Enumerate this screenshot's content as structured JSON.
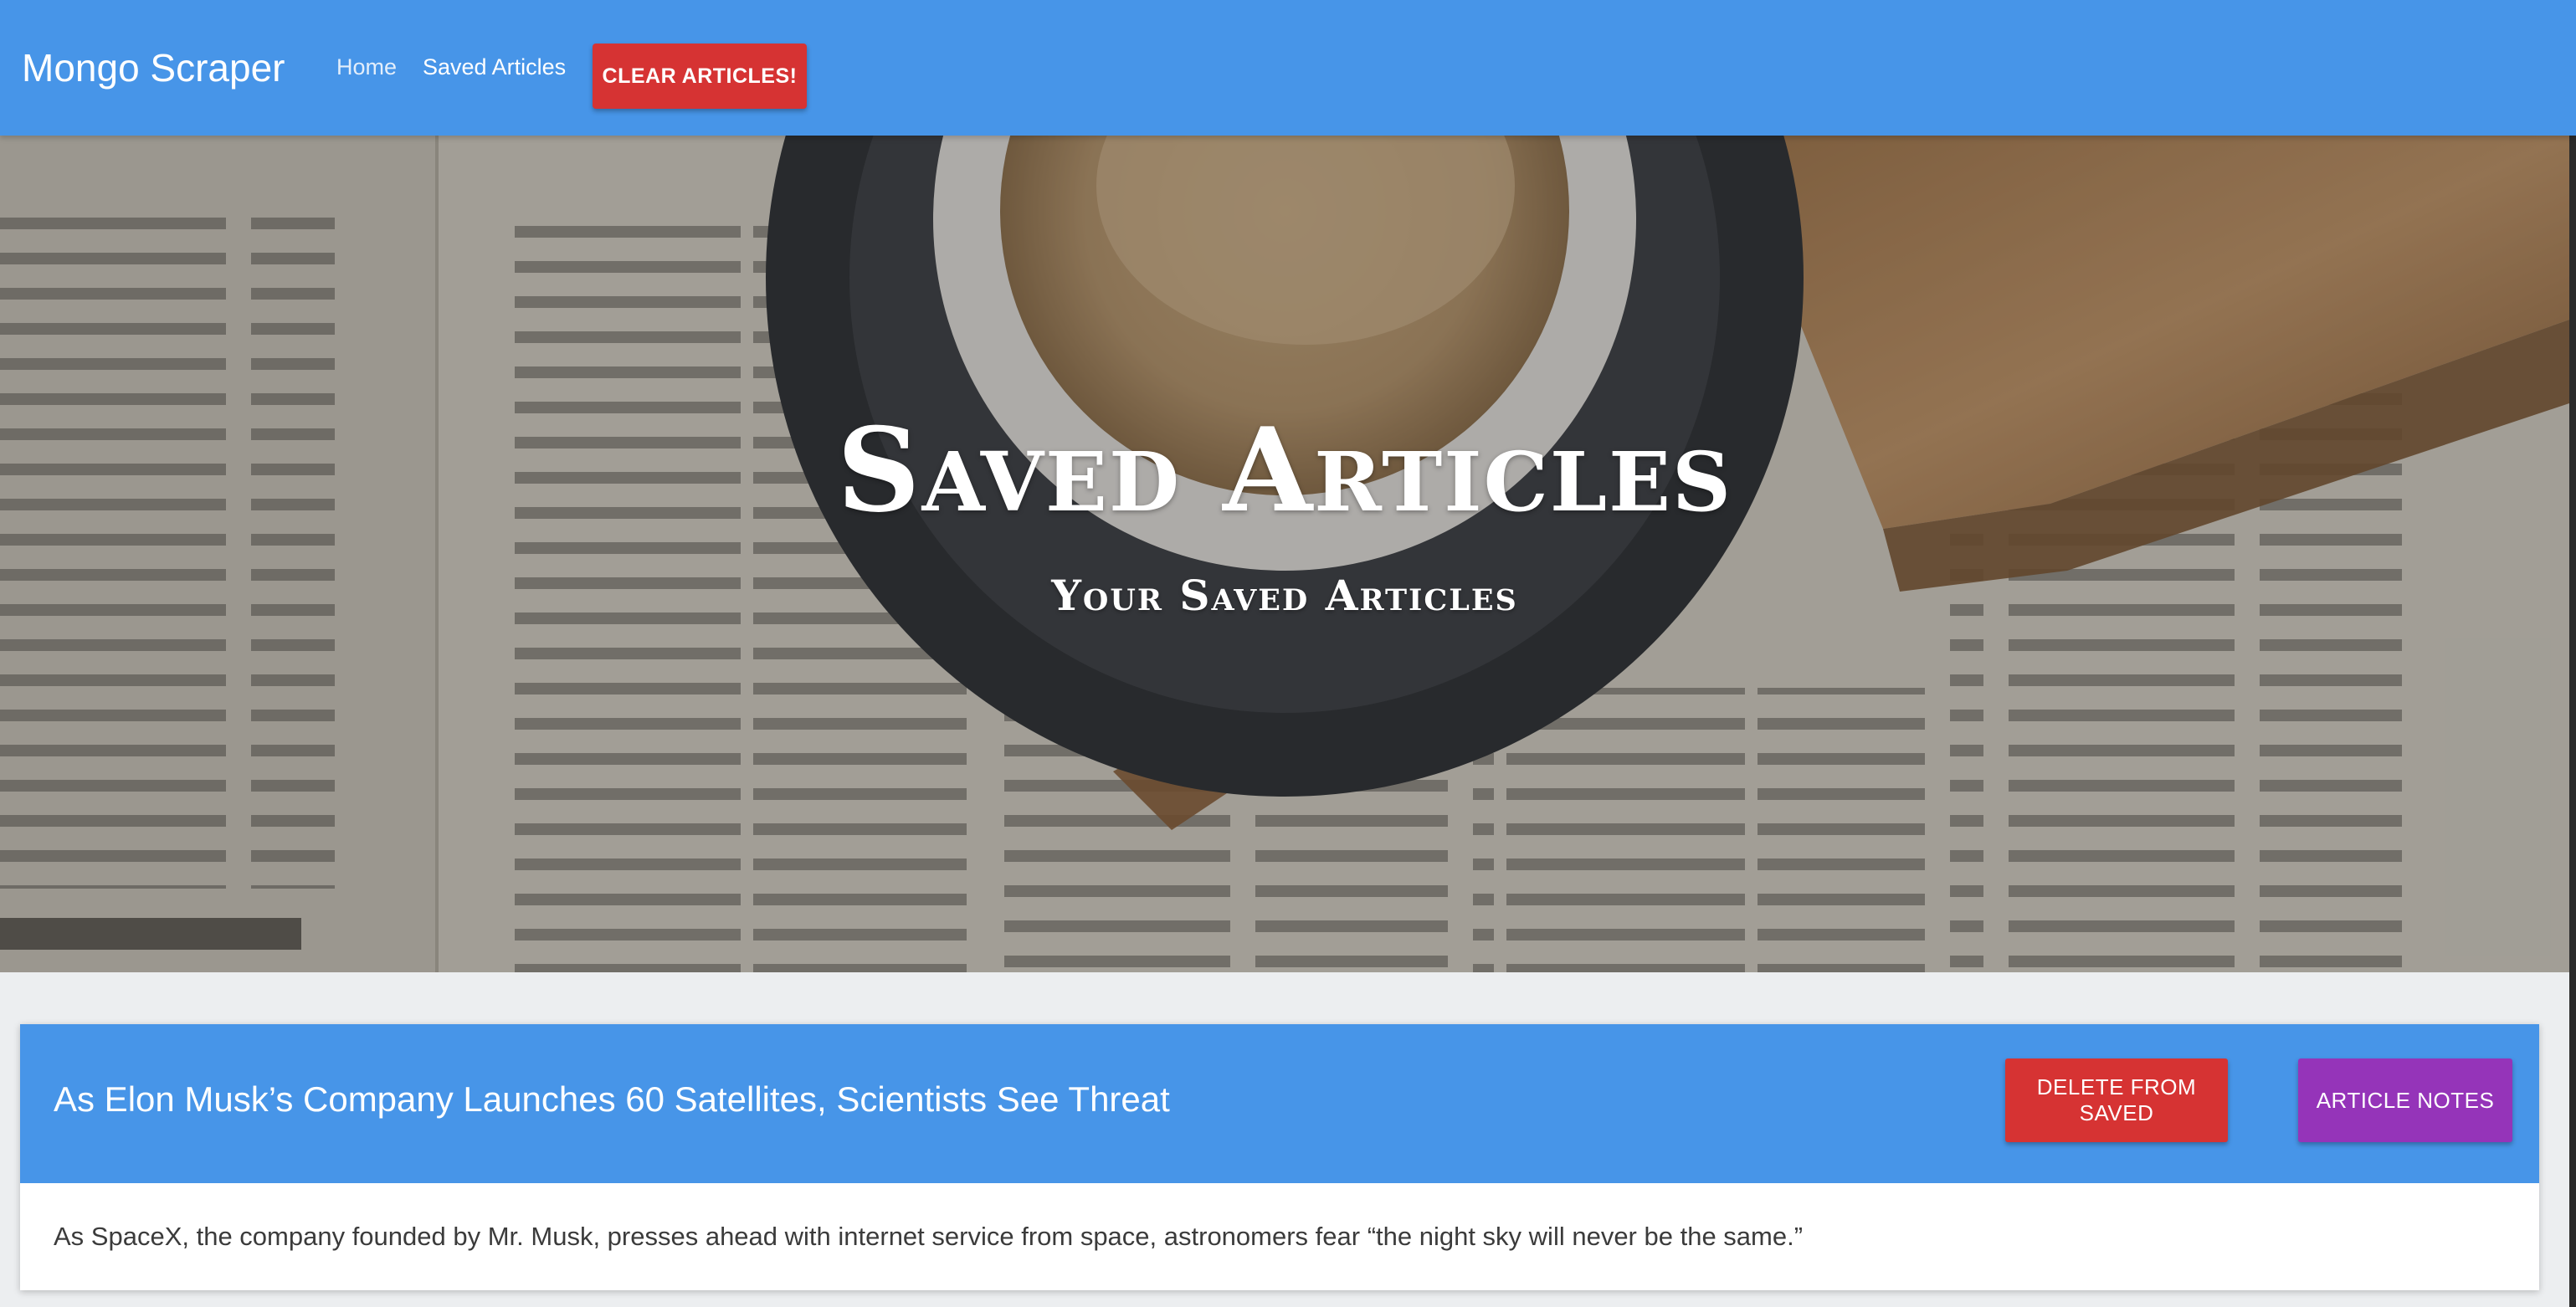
{
  "navbar": {
    "brand": "Mongo Scraper",
    "links": [
      {
        "label": "Home"
      },
      {
        "label": "Saved Articles"
      }
    ],
    "clear_button": "CLEAR ARTICLES!"
  },
  "hero": {
    "title": "Saved Articles",
    "subtitle": "Your Saved Articles"
  },
  "articles": [
    {
      "title": "As Elon Musk’s Company Launches 60 Satellites, Scientists See Threat",
      "summary": "As SpaceX, the company founded by Mr. Musk, presses ahead with internet service from space, astronomers fear “the night sky will never be the same.”",
      "delete_label": "DELETE FROM SAVED",
      "notes_label": "ARTICLE NOTES"
    }
  ],
  "colors": {
    "primary": "#4795e8",
    "danger": "#d63333",
    "notes": "#9534b9",
    "background": "#eceef0"
  },
  "icons": []
}
